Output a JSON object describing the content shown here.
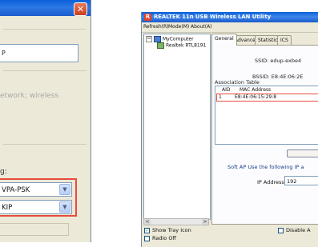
{
  "left_dialog": {
    "close_glyph": "✕",
    "ssid_value": "P",
    "description_text": "etwork; wireless",
    "encryption_label": "g:",
    "auth_value": "VPA-PSK",
    "cipher_value": "KIP",
    "dropdown_glyph": "▼"
  },
  "app": {
    "icon_glyph": "R",
    "title": "REALTEK 11n USB Wireless LAN Utility",
    "menu": [
      "Refresh(R)",
      "Mode(M)",
      "About(A)"
    ],
    "tree": {
      "expander_glyph": "⊟",
      "root": "MyComputer",
      "child": "Realtek RTL8191"
    },
    "tabs": [
      "General",
      "Advanced",
      "Statistics",
      "ICS"
    ],
    "general": {
      "ssid_label": "SSID: edup-exbe4",
      "bssid_label": "BSSID: E8:4E:06:2E",
      "assoc_table_label": "Association Table",
      "columns": [
        "AID",
        "MAC Address"
      ],
      "rows": [
        {
          "aid": "1",
          "mac": "E8:4E:06:15:29:8"
        }
      ],
      "softap_text": "Soft AP Use the following IP a",
      "ip_label": "IP Address:",
      "ip_value": "192"
    },
    "scroll_left_glyph": "<",
    "scroll_right_glyph": ">",
    "show_tray_label": "Show Tray Icon",
    "show_tray_checked": true,
    "check_glyph": "✓",
    "radio_off_label": "Radio Off",
    "radio_off_checked": false,
    "disable_label": "Disable A",
    "disable_checked": false
  }
}
